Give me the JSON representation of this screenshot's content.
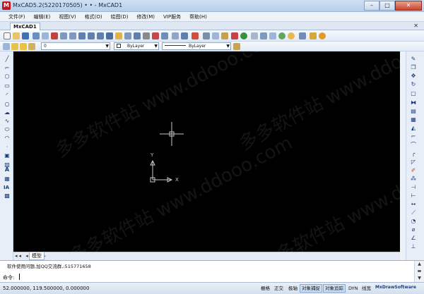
{
  "window": {
    "title": "MxCAD5.2(5220170505) • • - MxCAD1",
    "minimize": "–",
    "maximize": "□",
    "close": "✕"
  },
  "menu": [
    "文件(F)",
    "编辑(E)",
    "视图(V)",
    "格式(O)",
    "绘图(D)",
    "修改(M)",
    "VIP服务",
    "帮助(H)"
  ],
  "tabs": {
    "document": "MxCAD1",
    "close_glyph": "✕"
  },
  "properties_bar": {
    "layer_value": "0",
    "color_value": "ByLayer",
    "linetype_value": "ByLayer"
  },
  "canvas": {
    "watermark": "多多软件站 www.ddooo.com",
    "ucs_x": "X",
    "ucs_y": "Y"
  },
  "layout": {
    "model_tab": "模型",
    "nav_arrows": "◂◂ ◂ ▸ ▸▸"
  },
  "command": {
    "history_line": "软件使用问题,加QQ交流群,:515771658",
    "prompt": "命令:",
    "input_value": ""
  },
  "status": {
    "coordinates": "52.000000,  119.500000,  0.000000",
    "buttons": [
      "栅格",
      "正交",
      "极轴",
      "对象捕捉",
      "对象追踪",
      "DYN",
      "线宽"
    ],
    "active_buttons": [
      "对象捕捉",
      "对象追踪"
    ],
    "brand": "MxDrawSoftware"
  },
  "colors": {
    "canvas_bg": "#000000",
    "crosshair": "#c8c8c8",
    "chrome": "#d9e4f1"
  }
}
